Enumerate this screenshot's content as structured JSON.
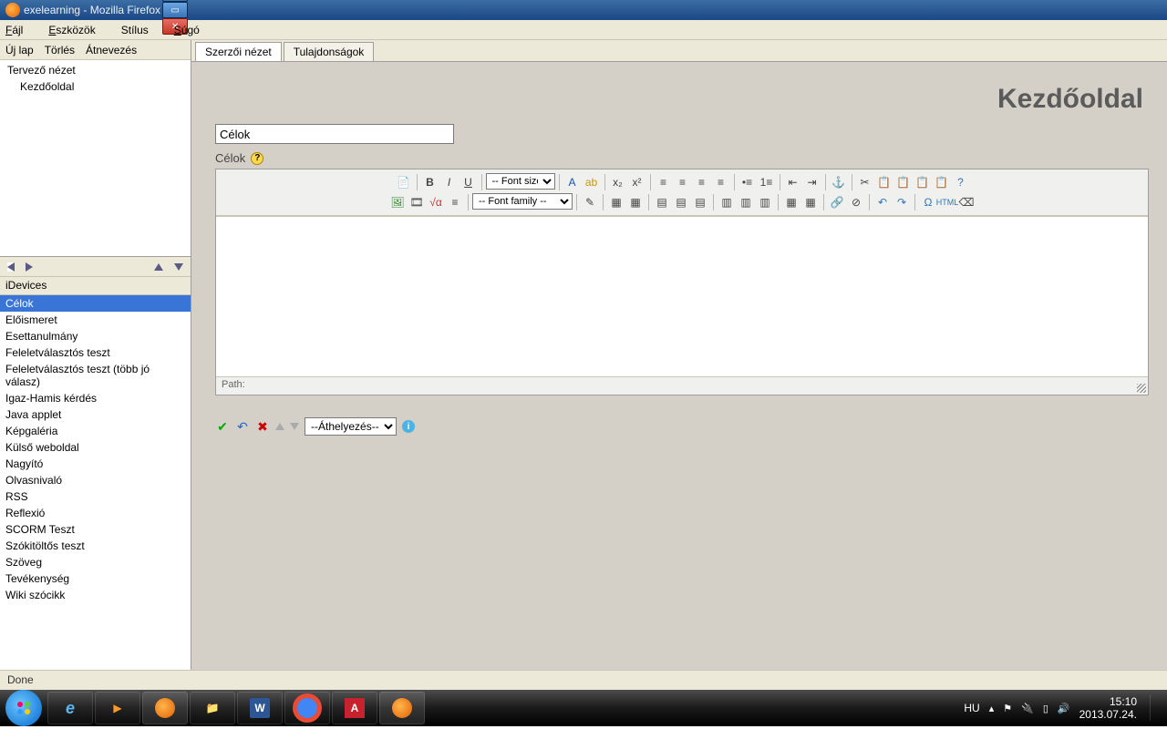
{
  "window": {
    "title": "exelearning - Mozilla Firefox"
  },
  "menu": {
    "file": "Fájl",
    "tools": "Eszközök",
    "style": "Stílus",
    "help": "Súgó"
  },
  "left_toolbar": {
    "newtab": "Új lap",
    "delete": "Törlés",
    "rename": "Átnevezés"
  },
  "tree": {
    "root": "Tervező nézet",
    "child": "Kezdőoldal"
  },
  "idevices": {
    "label": "iDevices",
    "items": [
      "Célok",
      "Előismeret",
      "Esettanulmány",
      "Feleletválasztós teszt",
      "Feleletválasztós teszt (több jó válasz)",
      "Igaz-Hamis kérdés",
      "Java applet",
      "Képgaléria",
      "Külső weboldal",
      "Nagyító",
      "Olvasnivaló",
      "RSS",
      "Reflexió",
      "SCORM Teszt",
      "Szókitöltős teszt",
      "Szöveg",
      "Tevékenység",
      "Wiki szócikk"
    ],
    "selected": 0
  },
  "tabs": {
    "author": "Szerzői nézet",
    "props": "Tulajdonságok"
  },
  "page": {
    "title": "Kezdőoldal",
    "input_value": "Célok",
    "section_label": "Célok"
  },
  "editor": {
    "font_size_placeholder": "-- Font size --",
    "font_family_placeholder": "-- Font family --",
    "path_label": "Path:"
  },
  "actions": {
    "move_placeholder": "--Áthelyezés--"
  },
  "status": {
    "text": "Done"
  },
  "taskbar": {
    "lang": "HU",
    "time": "15:10",
    "date": "2013.07.24."
  }
}
